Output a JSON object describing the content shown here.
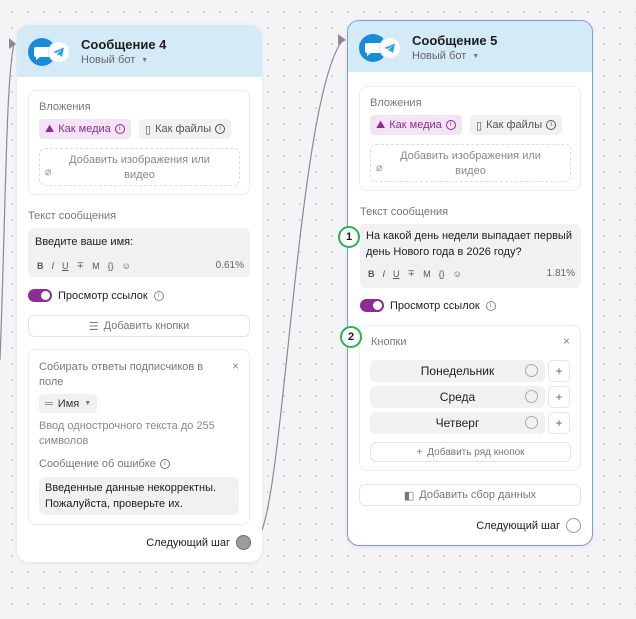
{
  "card_left": {
    "title": "Сообщение 4",
    "bot": "Новый бот",
    "attachments_label": "Вложения",
    "as_media": "Как медиа",
    "as_files": "Как файлы",
    "add_media": "Добавить изображения или видео",
    "message_label": "Текст сообщения",
    "message_text": "Введите ваше имя:",
    "format_b": "B",
    "format_i": "I",
    "format_u": "U",
    "format_s": "∓",
    "format_m": "M",
    "format_code": "{}",
    "format_emoji": "☺",
    "percent": "0.61%",
    "link_preview": "Просмотр ссылок",
    "add_buttons": "Добавить кнопки",
    "collect_title": "Собирать ответы подписчиков в поле",
    "field_name": "Имя",
    "input_hint": "Ввод однострочного текста до 255 символов",
    "error_label": "Сообщение об ошибке",
    "error_text": "Введенные данные некорректны. Пожалуйста, проверьте их.",
    "next_step": "Следующий шаг"
  },
  "card_right": {
    "title": "Сообщение 5",
    "bot": "Новый бот",
    "attachments_label": "Вложения",
    "as_media": "Как медиа",
    "as_files": "Как файлы",
    "add_media": "Добавить изображения или видео",
    "message_label": "Текст сообщения",
    "message_text": "На какой день недели выпадает первый день Нового года в 2026 году?",
    "format_b": "B",
    "format_i": "I",
    "format_u": "U",
    "format_s": "∓",
    "format_m": "M",
    "format_code": "{}",
    "format_emoji": "☺",
    "percent": "1.81%",
    "link_preview": "Просмотр ссылок",
    "buttons_label": "Кнопки",
    "buttons": [
      {
        "label": "Понедельник",
        "plus": "+"
      },
      {
        "label": "Среда",
        "plus": "+"
      },
      {
        "label": "Четверг",
        "plus": "+"
      }
    ],
    "add_button_row": "Добавить ряд кнопок",
    "add_data_collection": "Добавить сбор данных",
    "next_step": "Следующий шаг"
  },
  "badges": [
    "1",
    "2"
  ],
  "colors": {
    "header_bg": "#d4eaf7",
    "accent_purple": "#8c2d94",
    "telegram_blue": "#1a8bd8",
    "badge_green": "#2bb34b",
    "selected_border": "#7a9de8"
  }
}
